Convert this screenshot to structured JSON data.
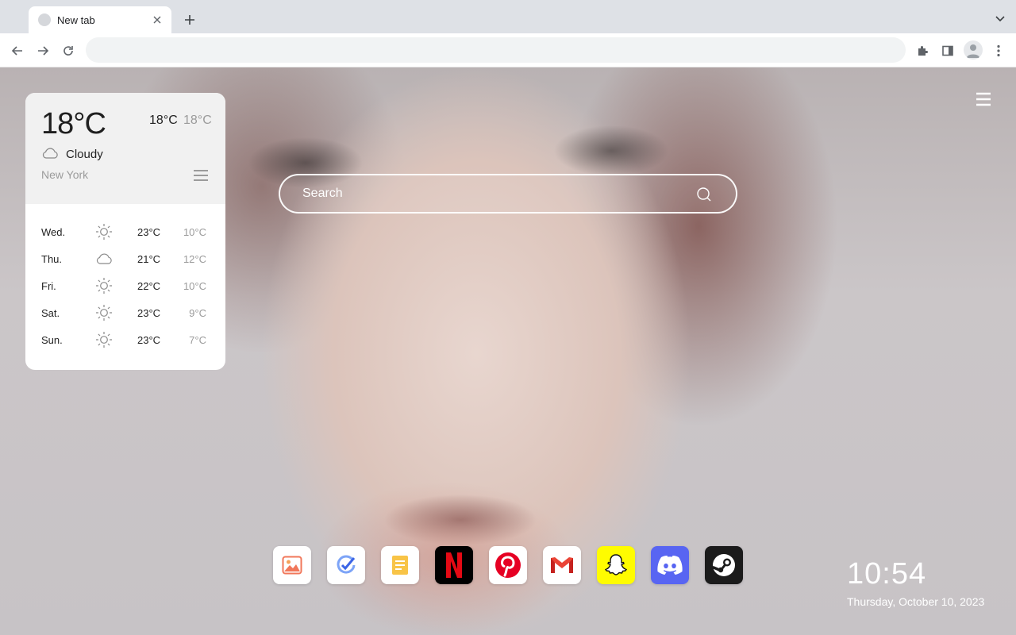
{
  "browser": {
    "tab_title": "New tab",
    "omnibox_value": ""
  },
  "weather": {
    "current_temp": "18°C",
    "high": "18°C",
    "low": "18°C",
    "condition": "Cloudy",
    "condition_icon": "cloud-icon",
    "city": "New York",
    "forecast": [
      {
        "day": "Wed.",
        "icon": "sun-icon",
        "high": "23°C",
        "low": "10°C"
      },
      {
        "day": "Thu.",
        "icon": "cloud-icon",
        "high": "21°C",
        "low": "12°C"
      },
      {
        "day": "Fri.",
        "icon": "sun-icon",
        "high": "22°C",
        "low": "10°C"
      },
      {
        "day": "Sat.",
        "icon": "sun-icon",
        "high": "23°C",
        "low": "9°C"
      },
      {
        "day": "Sun.",
        "icon": "sun-icon",
        "high": "23°C",
        "low": "7°C"
      }
    ]
  },
  "search": {
    "placeholder": "Search"
  },
  "dock": {
    "apps": [
      {
        "name": "photos-app",
        "icon": "image-icon",
        "bg": "#ffffff"
      },
      {
        "name": "tasks-app",
        "icon": "check-circle-icon",
        "bg": "#ffffff"
      },
      {
        "name": "notes-app",
        "icon": "note-icon",
        "bg": "#ffffff"
      },
      {
        "name": "netflix-app",
        "icon": "netflix-icon",
        "bg": "#000000"
      },
      {
        "name": "pinterest-app",
        "icon": "pinterest-icon",
        "bg": "#ffffff"
      },
      {
        "name": "gmail-app",
        "icon": "gmail-icon",
        "bg": "#ffffff"
      },
      {
        "name": "snapchat-app",
        "icon": "snapchat-icon",
        "bg": "#fffc00"
      },
      {
        "name": "discord-app",
        "icon": "discord-icon",
        "bg": "#5865f2"
      },
      {
        "name": "steam-app",
        "icon": "steam-icon",
        "bg": "#1b1b1b"
      }
    ]
  },
  "clock": {
    "time": "10:54",
    "date": "Thursday, October 10, 2023"
  },
  "colors": {
    "accent_netflix": "#e50914",
    "accent_pinterest": "#e60023",
    "accent_discord": "#5865f2",
    "accent_snapchat": "#fffc00"
  }
}
